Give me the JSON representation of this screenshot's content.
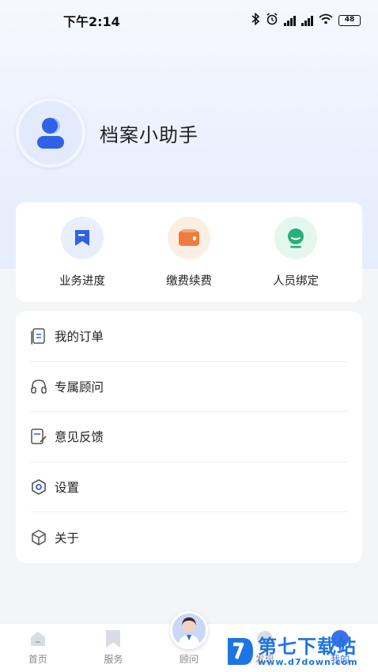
{
  "status_bar": {
    "time": "下午2:14",
    "battery": "48"
  },
  "profile": {
    "name": "档案小助手"
  },
  "quick_actions": [
    {
      "label": "业务进度",
      "icon": "bookmark-flag-icon",
      "color": "#2f62e8",
      "bg": "#e8eefc"
    },
    {
      "label": "缴费续费",
      "icon": "wallet-icon",
      "color": "#f07b3f",
      "bg": "#fdeee4"
    },
    {
      "label": "人员绑定",
      "icon": "person-bind-icon",
      "color": "#29b07a",
      "bg": "#e4f6ee"
    }
  ],
  "menu": [
    {
      "label": "我的订单",
      "icon": "order-document-icon"
    },
    {
      "label": "专属顾问",
      "icon": "headphones-icon"
    },
    {
      "label": "意见反馈",
      "icon": "feedback-edit-icon"
    },
    {
      "label": "设置",
      "icon": "settings-hexagon-icon"
    },
    {
      "label": "关于",
      "icon": "cube-icon"
    }
  ],
  "tabbar": [
    {
      "label": "首页",
      "icon": "home-icon"
    },
    {
      "label": "服务",
      "icon": "bookmark-icon"
    },
    {
      "label": "顾问",
      "icon": "advisor-avatar"
    },
    {
      "label": "发现",
      "icon": "discover-icon"
    },
    {
      "label": "我的",
      "icon": "profile-icon",
      "active": true
    }
  ],
  "watermark": {
    "title": "第七下载站",
    "url": "www.d7down.com"
  }
}
